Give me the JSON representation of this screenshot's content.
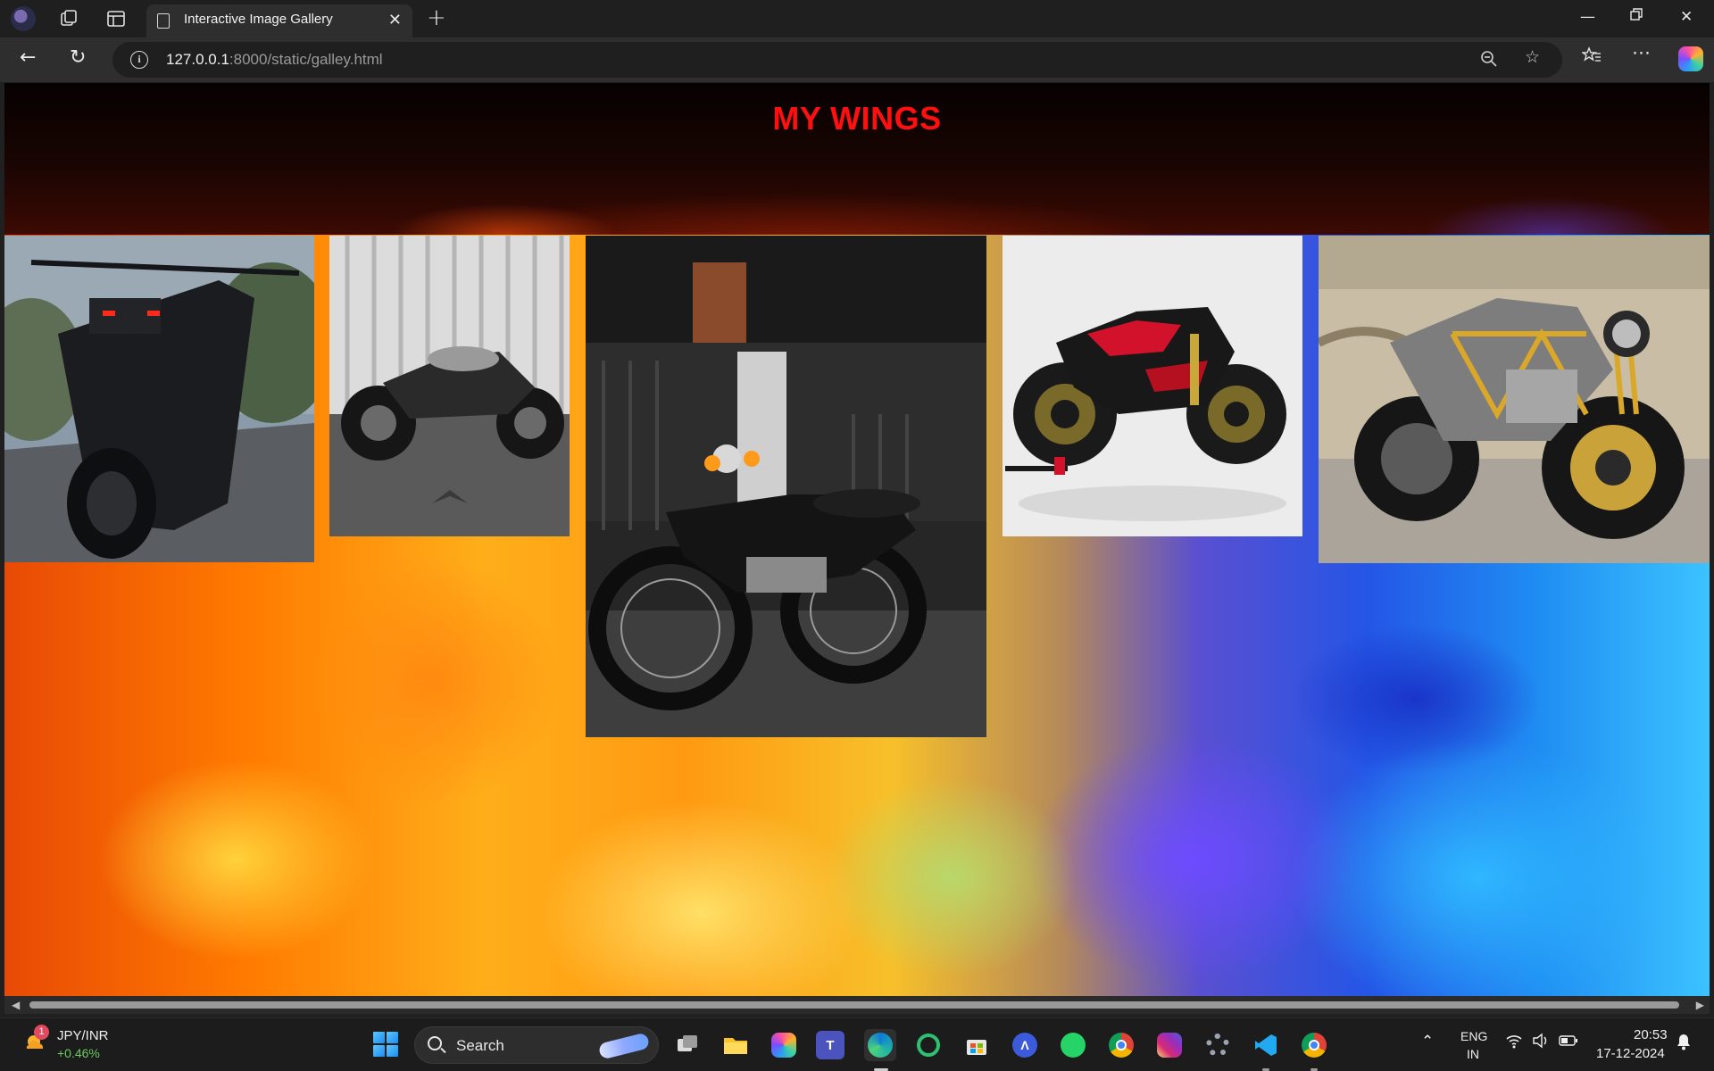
{
  "browser": {
    "tab_title": "Interactive Image Gallery",
    "url_host": "127.0.0.1",
    "url_rest": ":8000/static/galley.html"
  },
  "page": {
    "heading": "MY WINGS",
    "gallery": [
      {
        "name": "black-streetfighter-photo",
        "subject": "Matte black naked street bike on roadside"
      },
      {
        "name": "cafe-racer-photo",
        "subject": "Grey cafe racer against corrugated wall"
      },
      {
        "name": "classic-rx-photo",
        "subject": "Classic black two-stroke motorcycle on street"
      },
      {
        "name": "superbike-naked-photo",
        "subject": "Black and red naked superbike on stand"
      },
      {
        "name": "custom-trellis-photo",
        "subject": "Custom cafe racer with gold trellis frame"
      }
    ]
  },
  "taskbar": {
    "widget_badge": "1",
    "widget_name": "JPY/INR",
    "widget_change": "+0.46%",
    "search_label": "Search",
    "lang_line1": "ENG",
    "lang_line2": "IN",
    "time": "20:53",
    "date": "17-12-2024"
  },
  "colors": {
    "heading": "#ff1010",
    "browser_chrome": "#1f1f1f",
    "toolbar": "#2e2e2e"
  }
}
